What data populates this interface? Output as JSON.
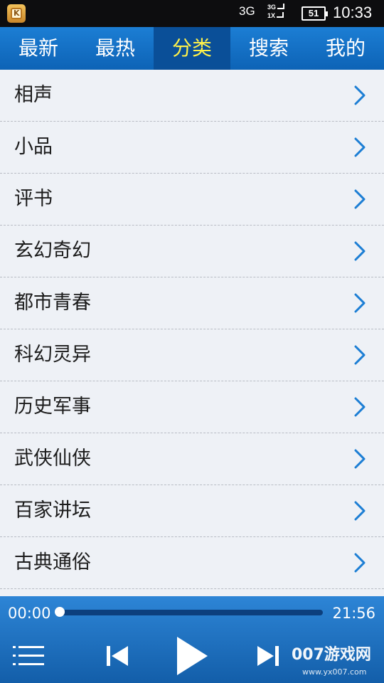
{
  "status_bar": {
    "network_1": "3G",
    "network_2_top": "3G",
    "network_2_bottom": "1X",
    "battery": "51",
    "time": "10:33"
  },
  "tabs": [
    {
      "label": "最新"
    },
    {
      "label": "最热"
    },
    {
      "label": "分类",
      "active": true
    },
    {
      "label": "搜索"
    },
    {
      "label": "我的"
    }
  ],
  "categories": [
    {
      "label": "相声"
    },
    {
      "label": "小品"
    },
    {
      "label": "评书"
    },
    {
      "label": "玄幻奇幻"
    },
    {
      "label": "都市青春"
    },
    {
      "label": "科幻灵异"
    },
    {
      "label": "历史军事"
    },
    {
      "label": "武侠仙侠"
    },
    {
      "label": "百家讲坛"
    },
    {
      "label": "古典通俗"
    }
  ],
  "player": {
    "current_time": "00:00",
    "total_time": "21:56",
    "progress": 0,
    "watermark": "007游戏网",
    "watermark_url": "www.yx007.com"
  },
  "colors": {
    "accent": "#1c7ed4",
    "active_tab_text": "#fff14a",
    "chevron": "#1c7ed4"
  },
  "icons": {
    "app": "app-k-icon",
    "row": "chevron-right-icon",
    "playlist": "playlist-icon",
    "prev": "skip-previous-icon",
    "play": "play-icon",
    "next": "skip-next-icon"
  }
}
